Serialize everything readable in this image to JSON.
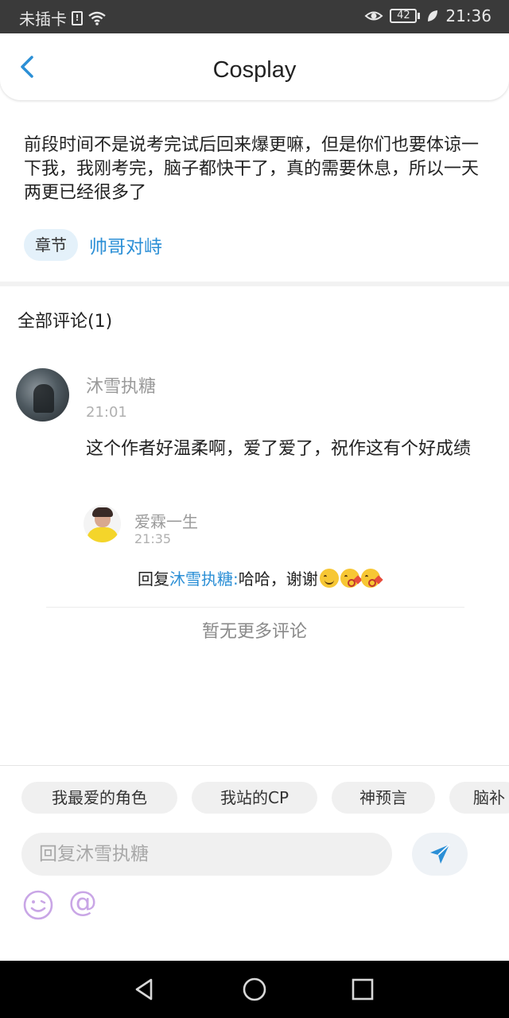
{
  "status_bar": {
    "carrier": "未插卡",
    "battery": "42",
    "time": "21:36"
  },
  "header": {
    "title": "Cosplay"
  },
  "post": {
    "body": "前段时间不是说考完试后回来爆更嘛，但是你们也要体谅一下我，我刚考完，脑子都快干了，真的需要休息，所以一天两更已经很多了",
    "chapter_tag": "章节",
    "chapter_title": "帅哥对峙"
  },
  "comments": {
    "header": "全部评论(1)",
    "items": [
      {
        "user": "沐雪执糖",
        "time": "21:01",
        "text": "这个作者好温柔啊，爱了爱了，祝作这有个好成绩",
        "reply": {
          "user": "爱霖一生",
          "time": "21:35",
          "prefix": "回复",
          "mention": "沐雪执糖:",
          "text": "哈哈，谢谢"
        }
      }
    ],
    "no_more": "暂无更多评论"
  },
  "input_panel": {
    "chips": [
      "我最爱的角色",
      "我站的CP",
      "神预言",
      "脑补"
    ],
    "placeholder": "回复沐雪执糖"
  },
  "colors": {
    "accent": "#2b8fd6",
    "status_bar_bg": "#3a3a3a",
    "send_icon": "#2b8fd6",
    "emoji_button": "#c9a6e6"
  },
  "icons": {
    "back": "chevron-left-icon",
    "send": "paper-plane-icon",
    "emoji": "smiley-icon",
    "mention": "at-icon"
  }
}
